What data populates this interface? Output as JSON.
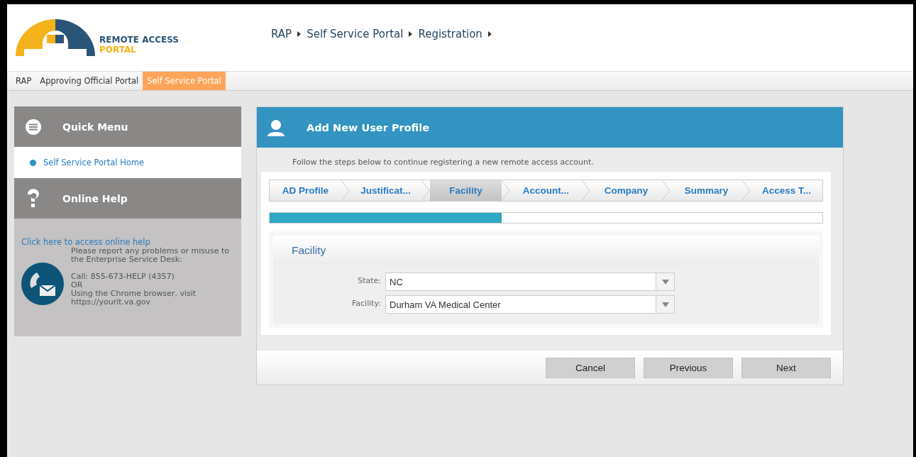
{
  "header": {
    "logo_line_1": "REMOTE ACCESS",
    "logo_line_2": "PORTAL",
    "breadcrumb": [
      "RAP",
      "Self Service Portal",
      "Registration"
    ]
  },
  "nav": [
    {
      "label": "RAP",
      "selected": false
    },
    {
      "label": "Approving Official Portal",
      "selected": false
    },
    {
      "label": "Self Service Portal",
      "selected": true
    }
  ],
  "sidebar": {
    "quick_menu": {
      "title": "Quick Menu",
      "items": [
        "Self Service Portal Home"
      ]
    },
    "online_help": {
      "title": "Online Help",
      "link": "Click here to access online help",
      "lines": [
        "Please report any problems or misuse to the Enterprise Service Desk:",
        "Call: 855-673-HELP (4357)",
        "OR",
        "Using the Chrome browser, visit https://yourit.va.gov"
      ]
    }
  },
  "panel": {
    "title": "Add New User Profile",
    "instructions": "Follow the steps below to continue registering a new remote access account.",
    "steps": [
      {
        "label": "AD Profile",
        "selected": false
      },
      {
        "label": "Justificat...",
        "selected": false
      },
      {
        "label": "Facility",
        "selected": true
      },
      {
        "label": "Account...",
        "selected": false
      },
      {
        "label": "Company",
        "selected": false
      },
      {
        "label": "Summary",
        "selected": false
      },
      {
        "label": "Access T...",
        "selected": false
      }
    ],
    "progress": {
      "level": 0.42
    },
    "section": {
      "title": "Facility",
      "fields": [
        {
          "label": "State:",
          "value": "NC"
        },
        {
          "label": "Facility:",
          "value": "Durham VA Medical Center"
        }
      ]
    },
    "buttons": [
      "Cancel",
      "Previous",
      "Next"
    ]
  }
}
